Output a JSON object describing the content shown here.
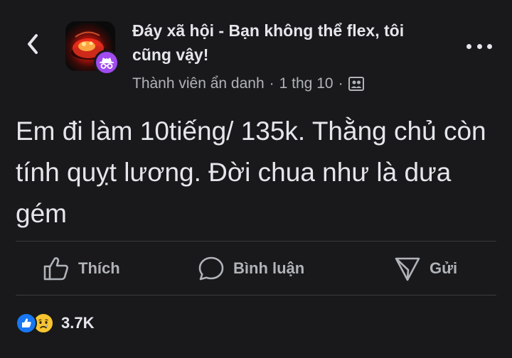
{
  "header": {
    "group_name": "Đáy xã hội - Bạn không thể flex, tôi cũng vậy!",
    "author": "Thành viên ẩn danh",
    "separator": "·",
    "timestamp": "1 thg 10",
    "audience_icon": "group-audience-icon",
    "back_icon": "chevron-left-icon",
    "more_icon": "more-options-icon"
  },
  "post": {
    "text": "Em đi làm 10tiếng/ 135k. Thằng chủ còn tính quỵt lương. Đời chua như là dưa gém"
  },
  "actions": {
    "like_label": "Thích",
    "comment_label": "Bình luận",
    "share_label": "Gửi"
  },
  "reactions": {
    "types": [
      "like",
      "sad"
    ],
    "count": "3.7K"
  },
  "colors": {
    "background": "#19191b",
    "text_primary": "#e4e6eb",
    "text_secondary": "#b0b3b8",
    "anon_badge": "#a04cf0",
    "like_blue": "#1877f2",
    "sad_yellow": "#f7c531"
  }
}
